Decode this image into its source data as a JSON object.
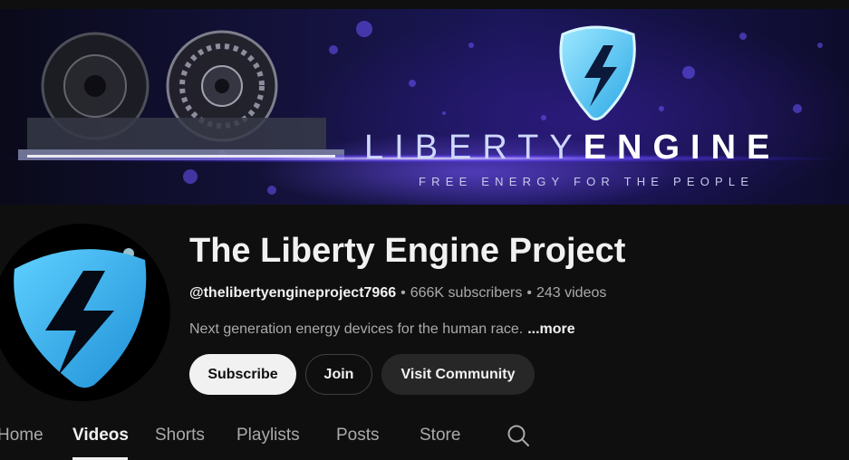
{
  "banner": {
    "title_part1": "LIBERTY",
    "title_part2": "ENGINE",
    "tagline": "FREE ENERGY FOR THE PEOPLE",
    "accent_color": "#5a3cff"
  },
  "channel": {
    "name": "The Liberty Engine Project",
    "handle": "@thelibertyengineproject7966",
    "separator": "•",
    "subscribers": "666K subscribers",
    "videos": "243 videos",
    "description": "Next generation energy devices for the human race.",
    "more_label": "...more",
    "logo_color": "#3fb8f0"
  },
  "actions": {
    "subscribe_label": "Subscribe",
    "join_label": "Join",
    "community_label": "Visit Community"
  },
  "tabs": [
    {
      "label": "Home"
    },
    {
      "label": "Videos",
      "active": true
    },
    {
      "label": "Shorts"
    },
    {
      "label": "Playlists"
    },
    {
      "label": "Posts"
    },
    {
      "label": "Store"
    }
  ],
  "search_icon": "search-icon"
}
